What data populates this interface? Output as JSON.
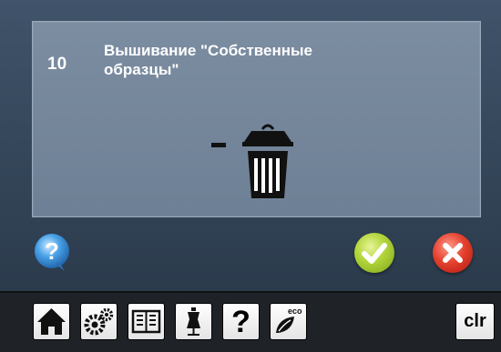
{
  "dialog": {
    "message_number": "10",
    "message_text": "Вышивание \"Собственные\nобразцы\""
  },
  "buttons": {
    "help_icon": "question-bubble-icon",
    "confirm_icon": "checkmark-icon",
    "cancel_icon": "x-icon",
    "confirm_color": "#8cc425",
    "cancel_color": "#d9301f"
  },
  "taskbar": {
    "items": [
      {
        "name": "home",
        "icon": "home-icon"
      },
      {
        "name": "setup",
        "icon": "gears-icon"
      },
      {
        "name": "tutorial",
        "icon": "book-icon"
      },
      {
        "name": "creative-consultant",
        "icon": "dress-form-icon"
      },
      {
        "name": "help",
        "label": "?"
      },
      {
        "name": "eco",
        "icon": "eco-leaf-icon",
        "label": "eco"
      },
      {
        "name": "clear",
        "label": "clr"
      }
    ]
  }
}
